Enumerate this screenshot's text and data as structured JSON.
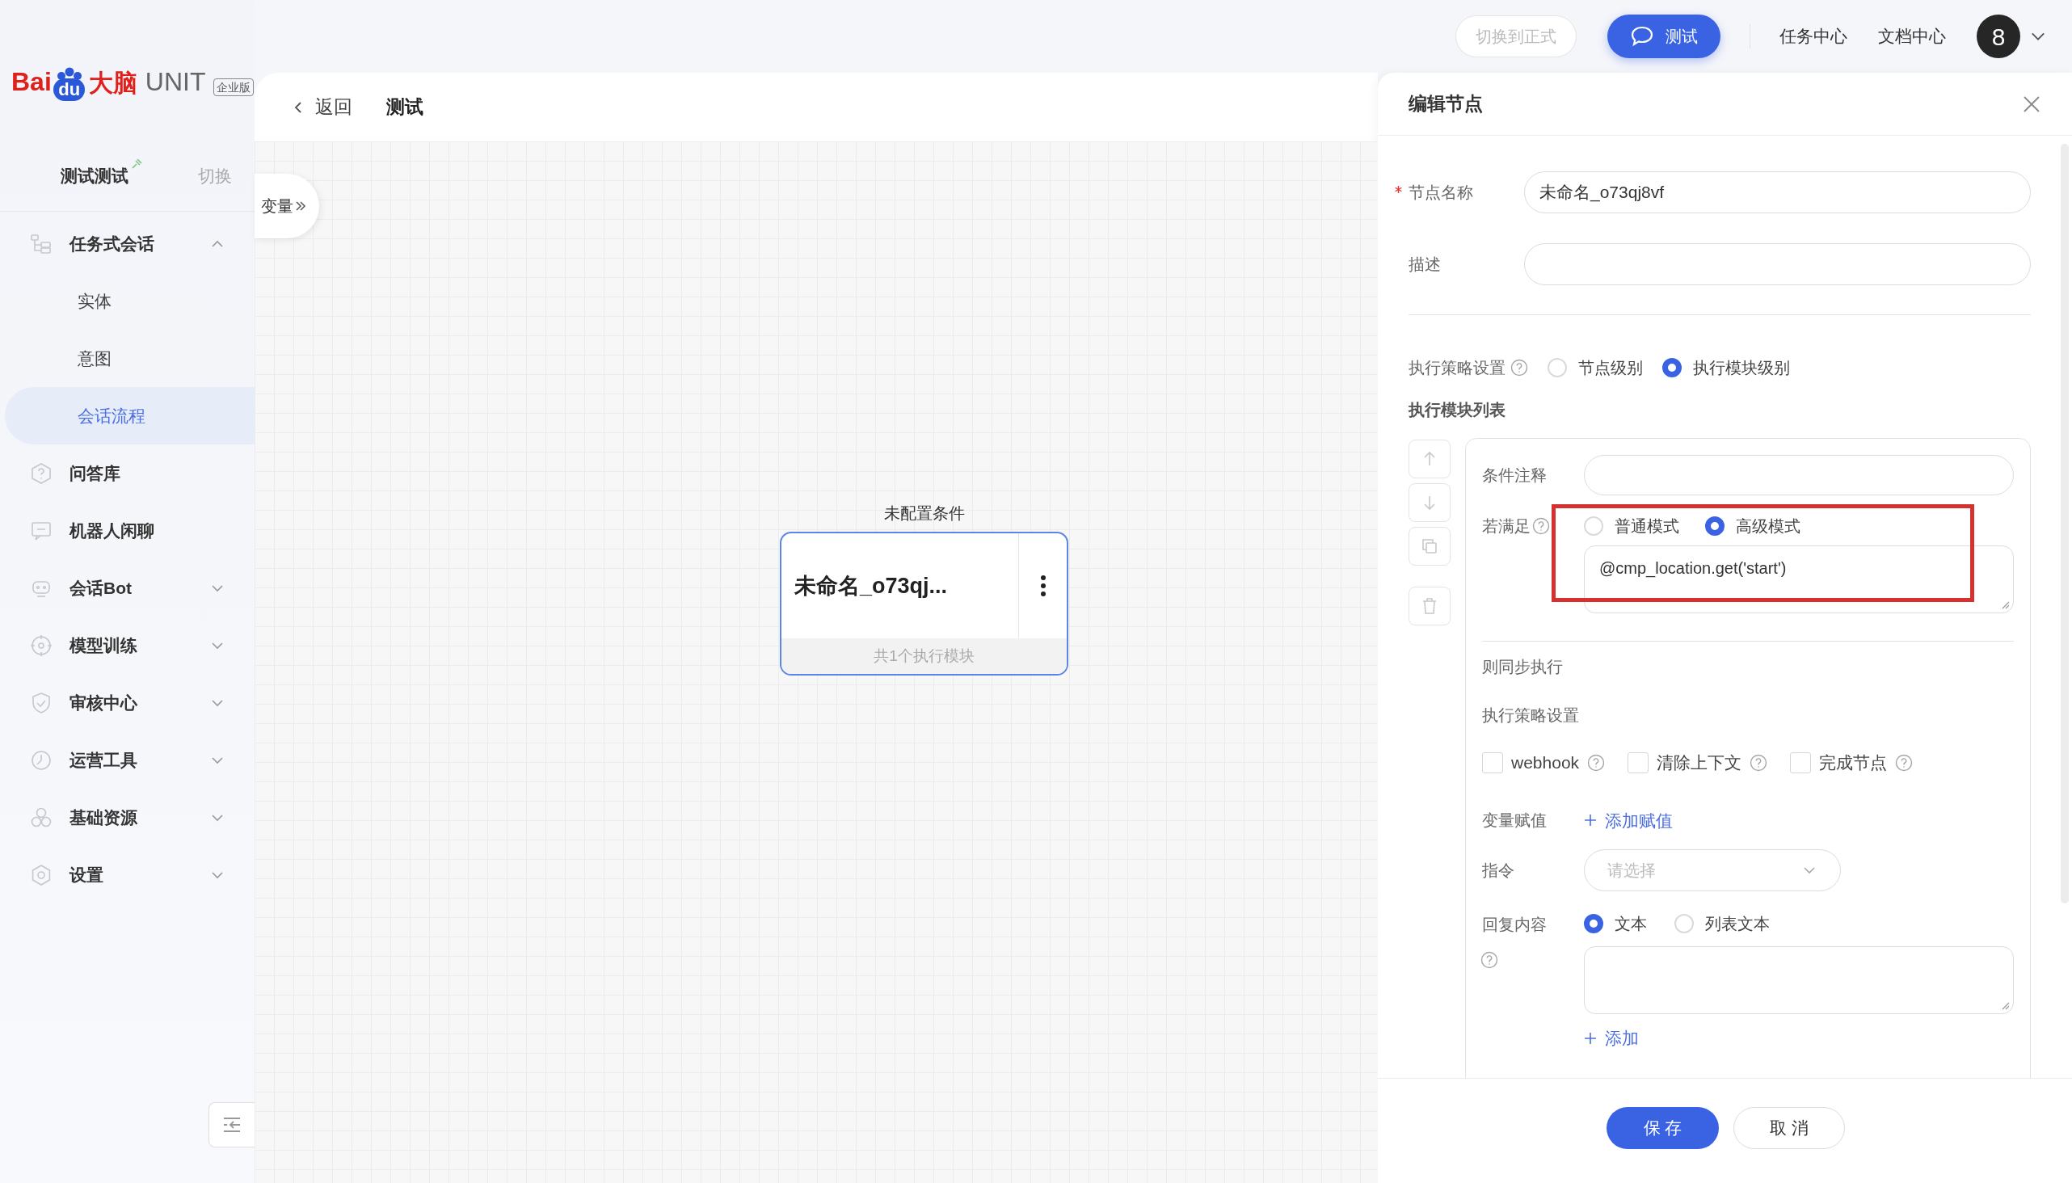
{
  "sidebar": {
    "logo": {
      "part_1": "Bai",
      "part_2": "du",
      "part_3": "大脑",
      "part_4": "UNIT",
      "badge": "企业版"
    },
    "project": {
      "name": "测试测试",
      "switch": "切换"
    },
    "menu": [
      {
        "label": "任务式会话",
        "selected": false,
        "expanded": true,
        "children": [
          {
            "label": "实体",
            "selected": false
          },
          {
            "label": "意图",
            "selected": false
          },
          {
            "label": "会话流程",
            "selected": true
          }
        ]
      },
      {
        "label": "问答库",
        "selected": false
      },
      {
        "label": "机器人闲聊",
        "selected": false
      },
      {
        "label": "会话Bot",
        "selected": false,
        "expanded": false
      },
      {
        "label": "模型训练",
        "selected": false,
        "expanded": false
      },
      {
        "label": "审核中心",
        "selected": false,
        "expanded": false
      },
      {
        "label": "运营工具",
        "selected": false,
        "expanded": false
      },
      {
        "label": "基础资源",
        "selected": false,
        "expanded": false
      },
      {
        "label": "设置",
        "selected": false,
        "expanded": false
      }
    ]
  },
  "top_bar": {
    "env_button": "切换到正式",
    "test_button": "测试",
    "links": [
      "任务中心",
      "文档中心"
    ],
    "avatar": "8"
  },
  "header": {
    "back": "返回",
    "title": "测试"
  },
  "canvas": {
    "variables_tab": "变量",
    "node": {
      "condition": "未配置条件",
      "name": "未命名_o73qj...",
      "footer": "共1个执行模块",
      "selected": true
    }
  },
  "panel": {
    "title": "编辑节点",
    "fields": [
      {
        "label": "节点名称",
        "required": true,
        "value": "未命名_o73qj8vf"
      },
      {
        "label": "描述",
        "required": false
      }
    ],
    "strategy": {
      "label": "执行策略设置",
      "options": [
        {
          "label": "节点级别",
          "selected": false
        },
        {
          "label": "执行模块级别",
          "selected": true
        }
      ]
    },
    "module_list_title": "执行模块列表",
    "module": {
      "note_label": "条件注释",
      "condition_label": "若满足",
      "modes": [
        {
          "label": "普通模式",
          "selected": false
        },
        {
          "label": "高级模式",
          "selected": true
        }
      ],
      "expression": "@cmp_location.get('start')",
      "highlighted": true,
      "then_label": "则同步执行",
      "strategy_label": "执行策略设置",
      "checkboxes": [
        {
          "label": "webhook",
          "checked": false
        },
        {
          "label": "清除上下文",
          "checked": false
        },
        {
          "label": "完成节点",
          "checked": false
        }
      ],
      "assign_label": "变量赋值",
      "assign_link": "添加赋值",
      "command_label": "指令",
      "command_placeholder": "请选择",
      "reply_label": "回复内容",
      "reply_types": [
        {
          "label": "文本",
          "selected": true
        },
        {
          "label": "列表文本",
          "selected": false
        }
      ],
      "add_link": "添加"
    },
    "buttons": {
      "save": "保 存",
      "cancel": "取 消"
    }
  }
}
